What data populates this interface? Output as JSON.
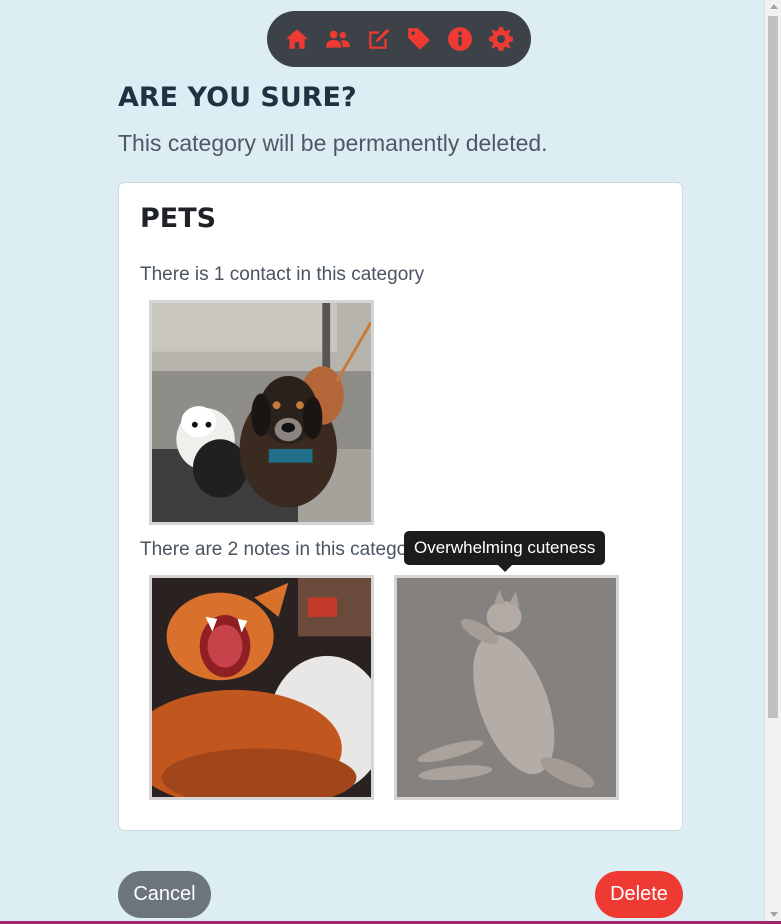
{
  "nav": {
    "items": [
      {
        "icon": "home-icon"
      },
      {
        "icon": "users-icon"
      },
      {
        "icon": "edit-icon"
      },
      {
        "icon": "tag-icon"
      },
      {
        "icon": "info-icon"
      },
      {
        "icon": "gear-icon"
      }
    ],
    "accent_color": "#ee3a33",
    "bar_color": "#3c4248"
  },
  "dialog": {
    "title": "ARE YOU SURE?",
    "message": "This category will be permanently deleted."
  },
  "category": {
    "name": "PETS",
    "contacts_text": "There is 1 contact in this category",
    "notes_text": "There are 2 notes in this category"
  },
  "tooltip": {
    "text": "Overwhelming cuteness"
  },
  "actions": {
    "cancel_label": "Cancel",
    "delete_label": "Delete",
    "cancel_color": "#6c757d",
    "delete_color": "#ee3a33"
  },
  "page": {
    "background": "#ddedf4"
  }
}
